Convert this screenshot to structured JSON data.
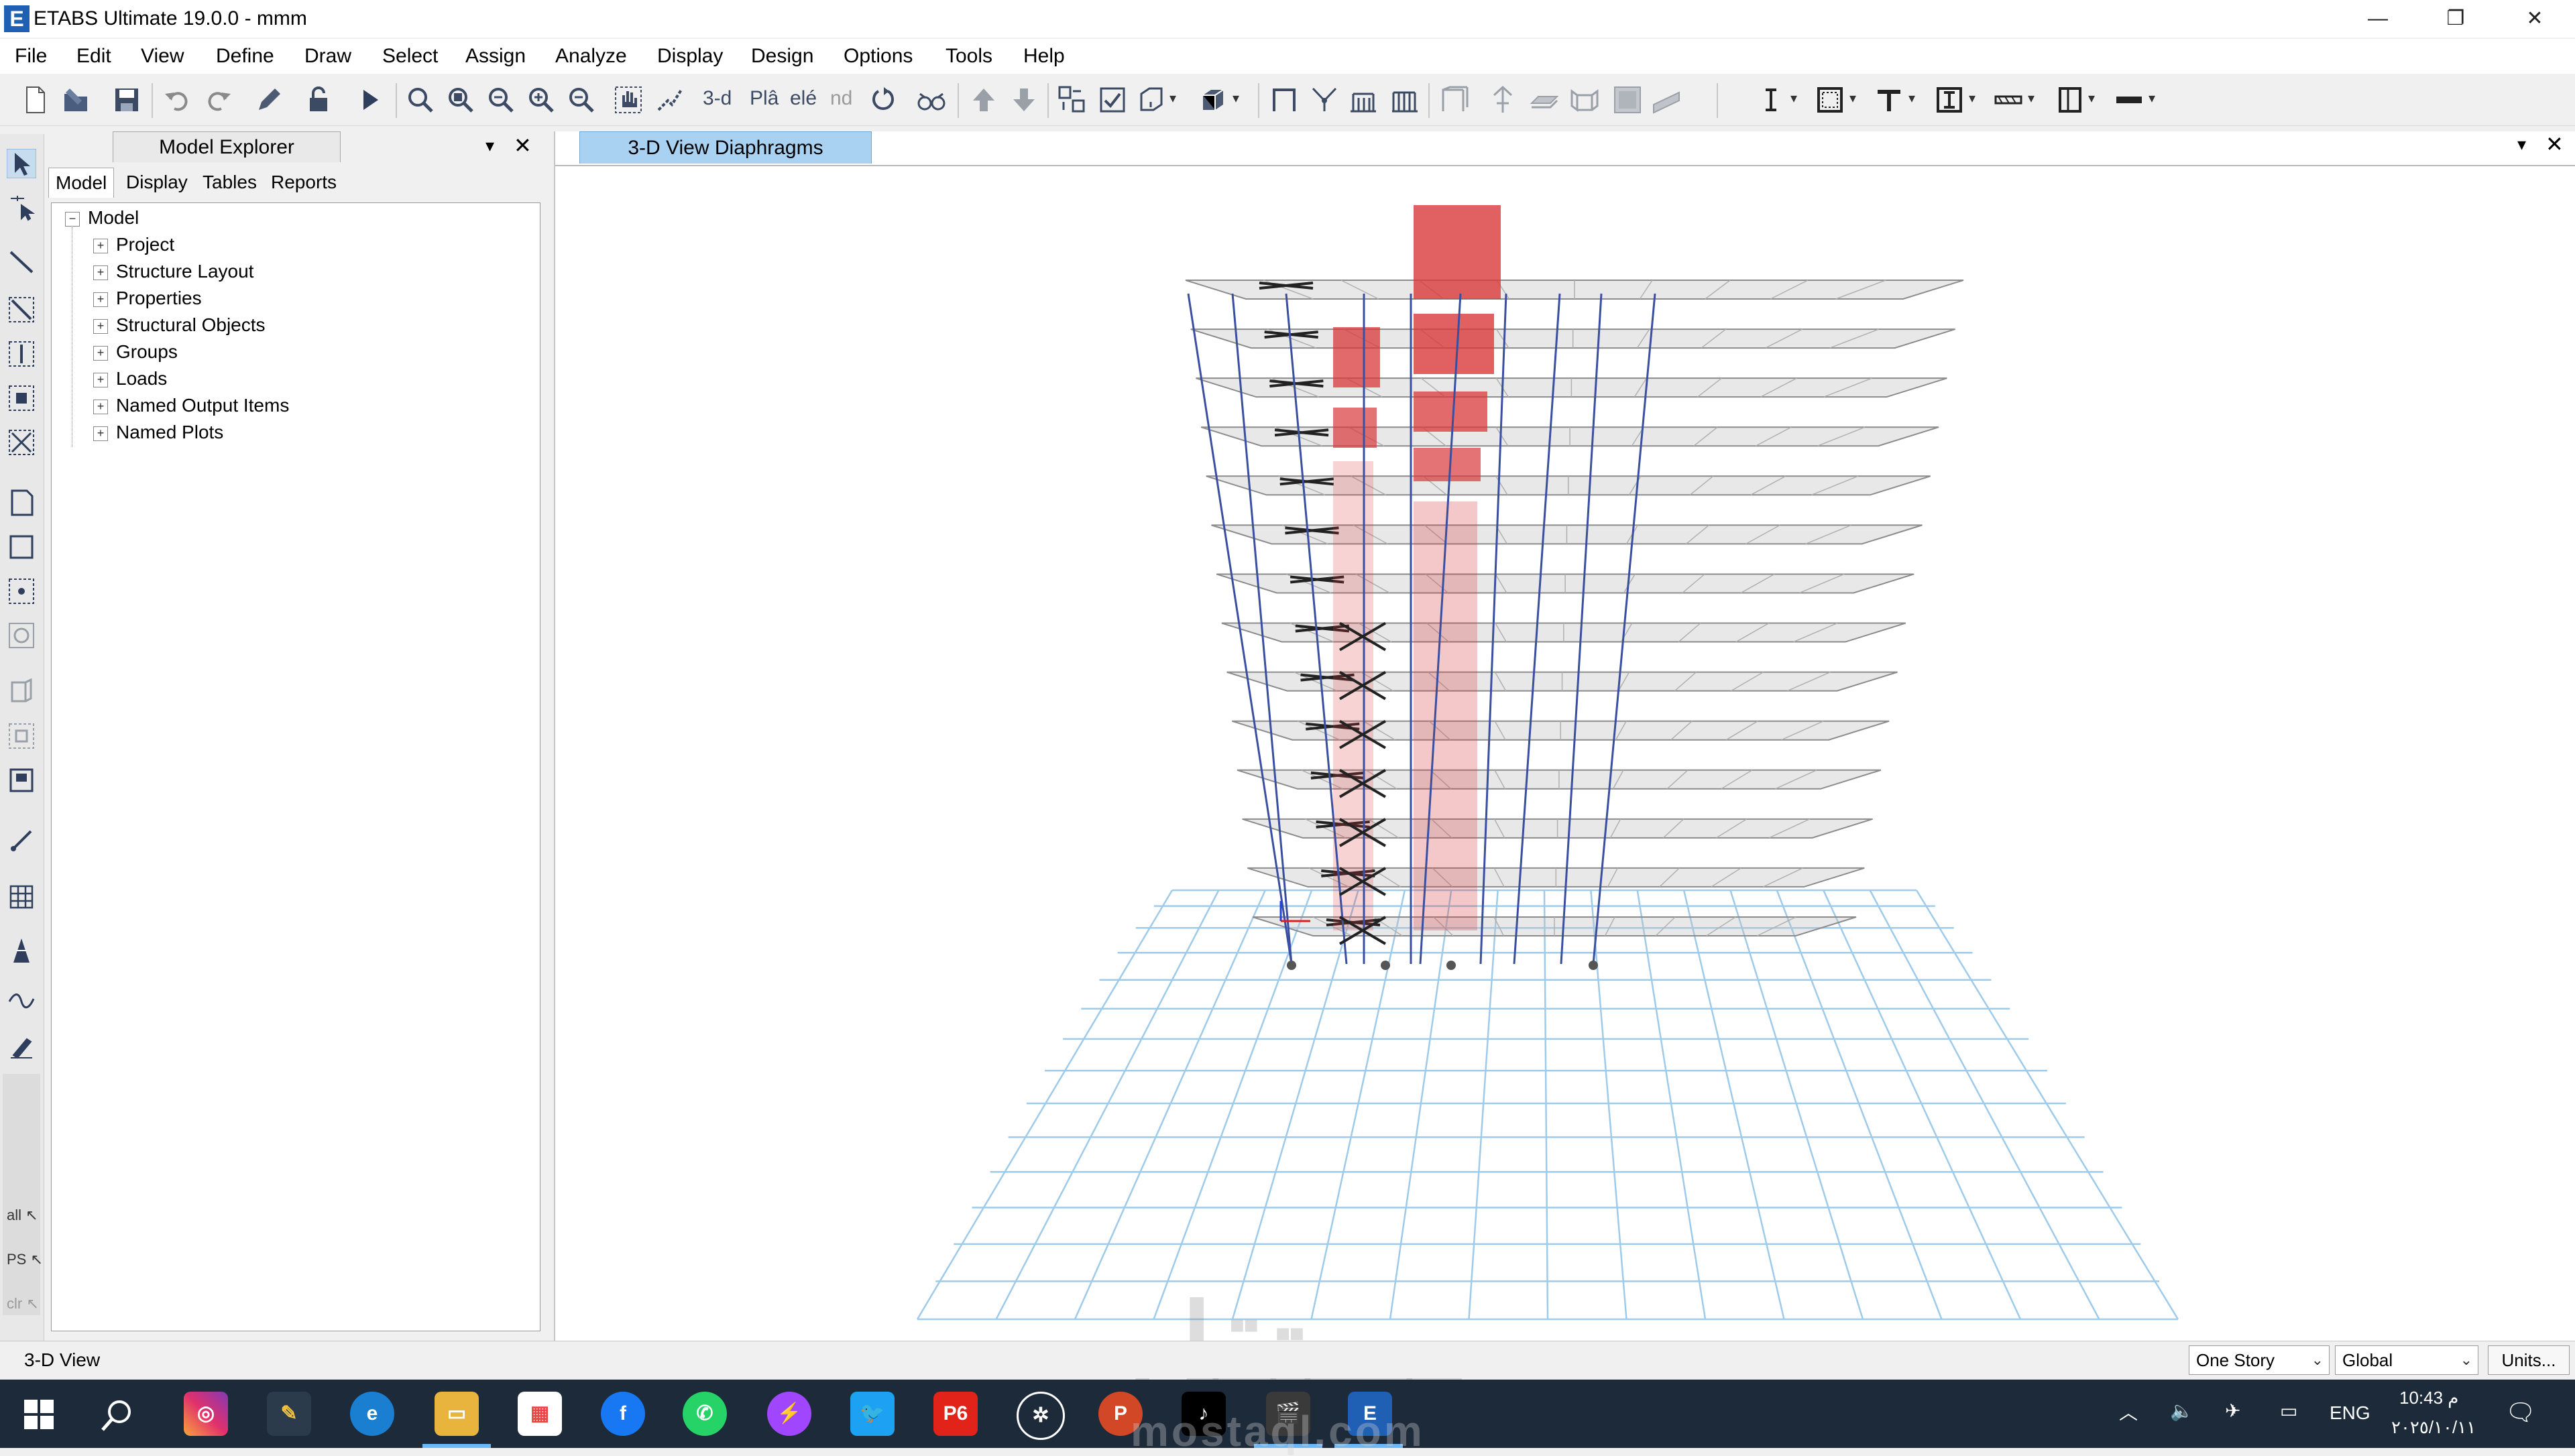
{
  "window": {
    "title": "ETABS Ultimate 19.0.0 - mmm",
    "logo_letter": "E",
    "controls": {
      "minimize": "—",
      "restore": "❐",
      "close": "✕"
    }
  },
  "menu": [
    "File",
    "Edit",
    "View",
    "Define",
    "Draw",
    "Select",
    "Assign",
    "Analyze",
    "Display",
    "Design",
    "Options",
    "Tools",
    "Help"
  ],
  "toolbar": {
    "view_3d_label": "3-d",
    "plan_label": "Plâ",
    "elev_label": "elé",
    "nd_label": "nd"
  },
  "explorer": {
    "title": "Model Explorer",
    "tabs": [
      "Model",
      "Display",
      "Tables",
      "Reports"
    ],
    "active_tab": "Model",
    "root": "Model",
    "items": [
      "Project",
      "Structure Layout",
      "Properties",
      "Structural Objects",
      "Groups",
      "Loads",
      "Named Output Items",
      "Named Plots"
    ],
    "expand_symbol": "+",
    "collapse_symbol": "−"
  },
  "left_tools": {
    "all_label": "all",
    "ps_label": "PS",
    "clr_label": "clr"
  },
  "view": {
    "tab_label": "3-D View  Diaphragms"
  },
  "status": {
    "text": "3-D View",
    "story_option": "One Story",
    "coord_option": "Global",
    "units_button": "Units..."
  },
  "taskbar": {
    "p6_label": "P6",
    "pp_label": "P",
    "etabs_label": "E",
    "language": "ENG",
    "time": "10:43 م",
    "date": "٢٠٢٥/١٠/١١"
  },
  "watermark": {
    "arabic": "مستقل",
    "latin": "mostaql.com"
  },
  "colors": {
    "frame_blue": "#3b4fa0",
    "wall_red": "#d9383a",
    "grid_blue": "#9fcbea",
    "tab_active": "#a9d2f2",
    "taskbar_bg": "#1c2a3a"
  }
}
